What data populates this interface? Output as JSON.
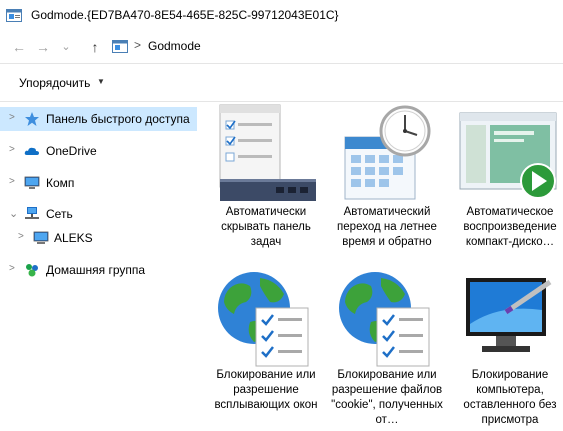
{
  "window": {
    "title": "Godmode.{ED7BA470-8E54-465E-825C-99712043E01C}"
  },
  "address": {
    "separator": ">",
    "crumb": "Godmode"
  },
  "toolbar": {
    "organize_label": "Упорядочить",
    "organize_caret": "▼"
  },
  "nav": {
    "back": "←",
    "forward": "→",
    "recent": "⌄",
    "up": "↑",
    "items": [
      {
        "label": "Панель быстрого доступа",
        "icon": "star-icon",
        "chevron": ">"
      },
      {
        "label": "OneDrive",
        "icon": "cloud-icon",
        "chevron": ">"
      },
      {
        "label": "Комп",
        "icon": "computer-icon",
        "chevron": ">"
      },
      {
        "label": "Сеть",
        "icon": "network-icon",
        "chevron": "⌄"
      },
      {
        "label": "ALEKS",
        "icon": "monitor-icon",
        "chevron": ">"
      },
      {
        "label": "Домашняя группа",
        "icon": "homegroup-icon",
        "chevron": ">"
      }
    ]
  },
  "tiles": [
    {
      "label": "Автоматически скрывать панель задач",
      "icon": "taskbar-settings-icon"
    },
    {
      "label": "Автоматический переход на летнее время и обратно",
      "icon": "calendar-clock-icon"
    },
    {
      "label": "Автоматическое воспроизведение компакт-диско…",
      "icon": "autoplay-icon"
    },
    {
      "label": "Блокирование или разрешение всплывающих окон",
      "icon": "globe-checklist-icon"
    },
    {
      "label": "Блокирование или разрешение файлов \"cookie\", полученных от…",
      "icon": "globe-checklist-icon"
    },
    {
      "label": "Блокирование компьютера, оставленного без присмотра",
      "icon": "monitor-pen-icon"
    }
  ],
  "colors": {
    "accent": "#0078d7",
    "selected_bg": "#cce8ff"
  }
}
